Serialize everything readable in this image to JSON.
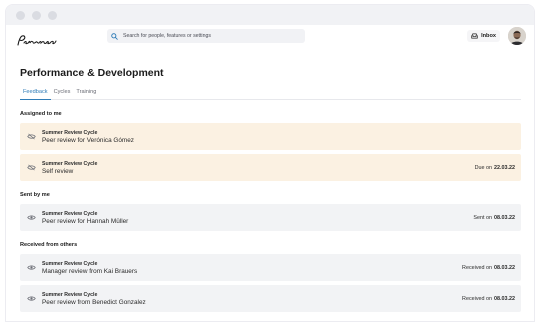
{
  "window": {
    "dots": [
      "close",
      "minimize",
      "maximize"
    ]
  },
  "topbar": {
    "logo_text": "Personio",
    "search_placeholder": "Search for people, features or settings",
    "inbox_label": "Inbox"
  },
  "page": {
    "title": "Performance & Development",
    "tabs": [
      {
        "label": "Feedback",
        "active": true
      },
      {
        "label": "Cycles",
        "active": false
      },
      {
        "label": "Training",
        "active": false
      }
    ]
  },
  "sections": {
    "assigned": {
      "label": "Assigned to me",
      "items": [
        {
          "cycle": "Summer Review Cycle",
          "description": "Peer review for Verónica Gómez",
          "meta_label": "",
          "meta_date": "",
          "icon": "eye-off-icon"
        },
        {
          "cycle": "Summer Review Cycle",
          "description": "Self review",
          "meta_label": "Due on",
          "meta_date": "22.03.22",
          "icon": "eye-off-icon"
        }
      ]
    },
    "sent": {
      "label": "Sent by me",
      "items": [
        {
          "cycle": "Summer Review Cycle",
          "description": "Peer review for Hannah Müller",
          "meta_label": "Sent on",
          "meta_date": "08.03.22",
          "icon": "eye-icon"
        }
      ]
    },
    "received": {
      "label": "Received from others",
      "items": [
        {
          "cycle": "Summer Review Cycle",
          "description": "Manager review from Kai Brauers",
          "meta_label": "Received on",
          "meta_date": "08.03.22",
          "icon": "eye-icon"
        },
        {
          "cycle": "Summer Review Cycle",
          "description": "Peer review from Benedict Gonzalez",
          "meta_label": "Received on",
          "meta_date": "08.03.22",
          "icon": "eye-icon"
        }
      ]
    }
  },
  "colors": {
    "accent": "#2f7cb7",
    "assigned_bg": "#fbf1e2",
    "neutral_bg": "#f2f3f5"
  }
}
